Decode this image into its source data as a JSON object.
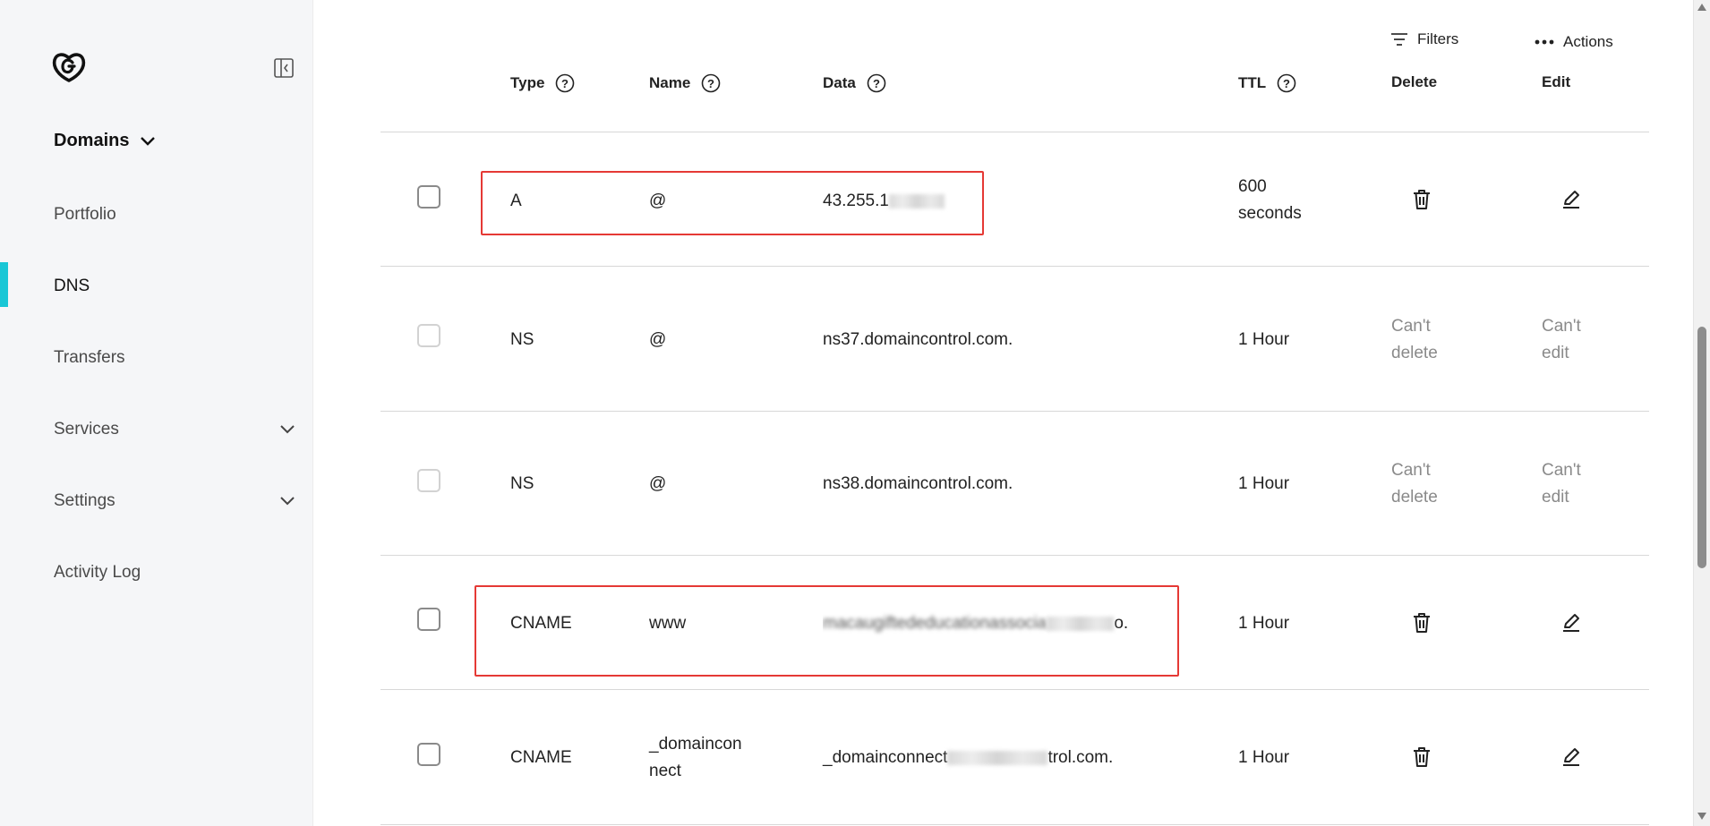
{
  "sidebar": {
    "logo_icon": "godaddy-logo-icon",
    "section_title": "Domains",
    "items": [
      {
        "label": "Portfolio"
      },
      {
        "label": "DNS"
      },
      {
        "label": "Transfers"
      },
      {
        "label": "Services"
      },
      {
        "label": "Settings"
      },
      {
        "label": "Activity Log"
      }
    ],
    "active_color": "#19c7d6"
  },
  "toolbar": {
    "filters_label": "Filters",
    "actions_label": "Actions"
  },
  "table": {
    "headers": {
      "type": "Type",
      "name": "Name",
      "data": "Data",
      "ttl": "TTL",
      "delete": "Delete",
      "edit": "Edit"
    },
    "rows": [
      {
        "type": "A",
        "name": "@",
        "data": "43.255.1",
        "ttl_line1": "600",
        "ttl_line2": "seconds"
      },
      {
        "type": "NS",
        "name": "@",
        "data": "ns37.domaincontrol.com.",
        "ttl": "1 Hour",
        "delete_line1": "Can't",
        "delete_line2": "delete",
        "edit_line1": "Can't",
        "edit_line2": "edit"
      },
      {
        "type": "NS",
        "name": "@",
        "data": "ns38.domaincontrol.com.",
        "ttl": "1 Hour",
        "delete_line1": "Can't",
        "delete_line2": "delete",
        "edit_line1": "Can't",
        "edit_line2": "edit"
      },
      {
        "type": "CNAME",
        "name": "www",
        "data_prefix": "macaugiftededucationassocia",
        "data_suffix": "o.",
        "ttl": "1 Hour"
      },
      {
        "type": "CNAME",
        "name_line1": "_domaincon",
        "name_line2": "nect",
        "data_prefix": "_domainconnect",
        "data_suffix": "trol.com.",
        "ttl": "1 Hour"
      }
    ]
  },
  "highlight_color": "#e53935"
}
